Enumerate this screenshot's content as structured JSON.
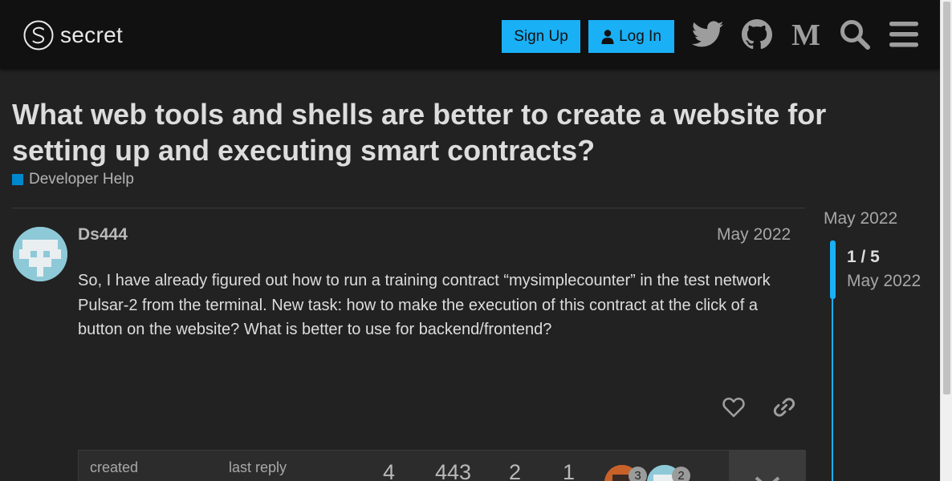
{
  "header": {
    "logo_text": "secret",
    "signup_label": "Sign Up",
    "login_label": "Log In",
    "icons": [
      "twitter-icon",
      "github-icon",
      "medium-icon",
      "search-icon",
      "menu-icon"
    ]
  },
  "topic": {
    "title": "What web tools and shells are better to create a website for setting up and executing smart contracts?",
    "category": "Developer Help",
    "category_color": "#0088cc"
  },
  "post": {
    "username": "Ds444",
    "date": "May 2022",
    "body": "So, I have already figured out how to run a training contract “mysimplecounter” in the test network Pulsar-2 from the terminal. New task: how to make the execution of this contract at the click of a button on the website? What is better to use for backend/frontend?"
  },
  "topic_map": {
    "created_label": "created",
    "last_reply_label": "last reply",
    "replies": "4",
    "views": "443",
    "users": "2",
    "links": "1",
    "participants": [
      {
        "count": "3"
      },
      {
        "count": "2"
      }
    ]
  },
  "timeline": {
    "start_date": "May 2022",
    "position": "1 / 5",
    "current_date": "May 2022"
  },
  "colors": {
    "accent": "#1ab0f5",
    "header_bg": "#111111",
    "page_bg": "#222222"
  }
}
